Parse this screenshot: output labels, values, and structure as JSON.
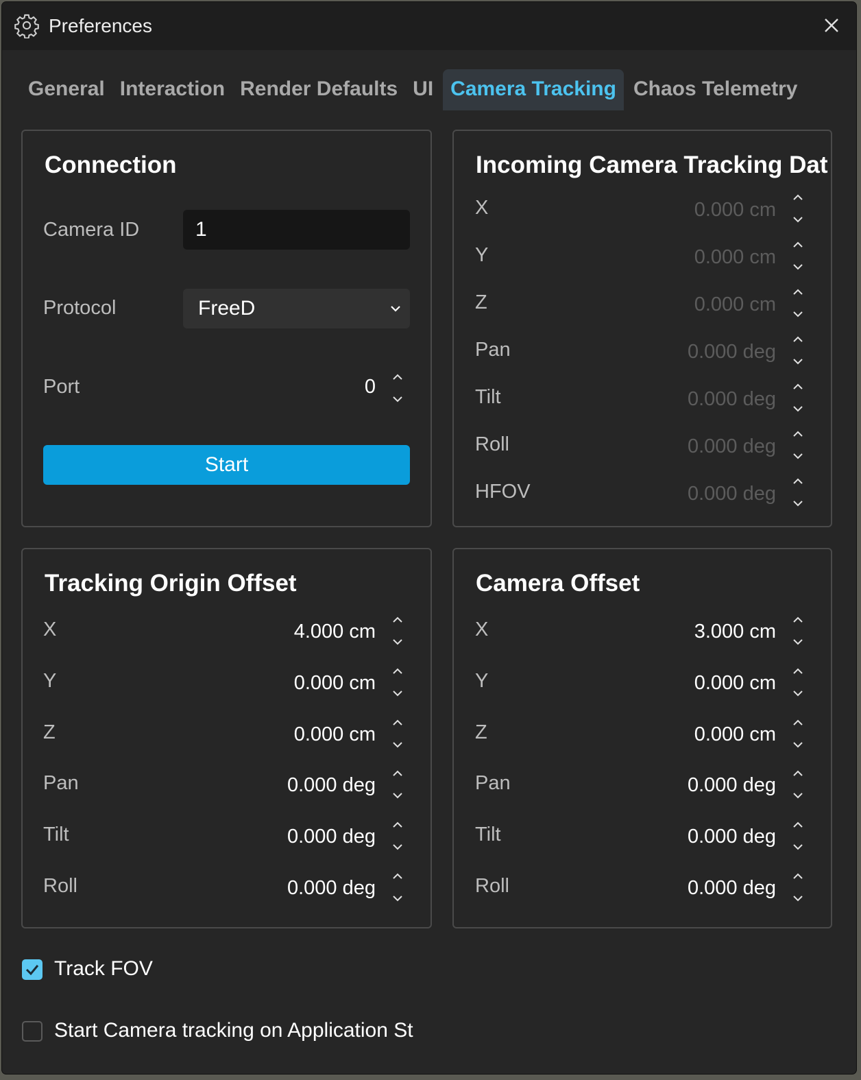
{
  "window": {
    "title": "Preferences",
    "icon": "gear-icon",
    "close_icon": "close-icon"
  },
  "tabs": [
    {
      "label": "General",
      "active": false
    },
    {
      "label": "Interaction",
      "active": false
    },
    {
      "label": "Render Defaults",
      "active": false
    },
    {
      "label": "UI",
      "active": false
    },
    {
      "label": "Camera Tracking",
      "active": true
    },
    {
      "label": "Chaos Telemetry",
      "active": false
    }
  ],
  "connection": {
    "title": "Connection",
    "camera_id_label": "Camera ID",
    "camera_id_value": "1",
    "protocol_label": "Protocol",
    "protocol_value": "FreeD",
    "port_label": "Port",
    "port_value": "0",
    "start_label": "Start"
  },
  "incoming": {
    "title": "Incoming Camera Tracking Dat",
    "rows": [
      {
        "label": "X",
        "value": "0.000 cm"
      },
      {
        "label": "Y",
        "value": "0.000 cm"
      },
      {
        "label": "Z",
        "value": "0.000 cm"
      },
      {
        "label": "Pan",
        "value": "0.000 deg"
      },
      {
        "label": "Tilt",
        "value": "0.000 deg"
      },
      {
        "label": "Roll",
        "value": "0.000 deg"
      },
      {
        "label": "HFOV",
        "value": "0.000 deg"
      }
    ]
  },
  "tracking_origin_offset": {
    "title": "Tracking Origin Offset",
    "rows": [
      {
        "label": "X",
        "value": "4.000 cm"
      },
      {
        "label": "Y",
        "value": "0.000 cm"
      },
      {
        "label": "Z",
        "value": "0.000 cm"
      },
      {
        "label": "Pan",
        "value": "0.000 deg"
      },
      {
        "label": "Tilt",
        "value": "0.000 deg"
      },
      {
        "label": "Roll",
        "value": "0.000 deg"
      }
    ]
  },
  "camera_offset": {
    "title": "Camera Offset",
    "rows": [
      {
        "label": "X",
        "value": "3.000 cm"
      },
      {
        "label": "Y",
        "value": "0.000 cm"
      },
      {
        "label": "Z",
        "value": "0.000 cm"
      },
      {
        "label": "Pan",
        "value": "0.000 deg"
      },
      {
        "label": "Tilt",
        "value": "0.000 deg"
      },
      {
        "label": "Roll",
        "value": "0.000 deg"
      }
    ]
  },
  "options": {
    "track_fov_label": "Track FOV",
    "track_fov_checked": true,
    "start_on_launch_label": "Start Camera tracking on Application St",
    "start_on_launch_checked": false
  },
  "colors": {
    "accent": "#4cc3ef",
    "button": "#0a9ddb",
    "checkbox": "#5cc8f2",
    "background": "#262626"
  }
}
